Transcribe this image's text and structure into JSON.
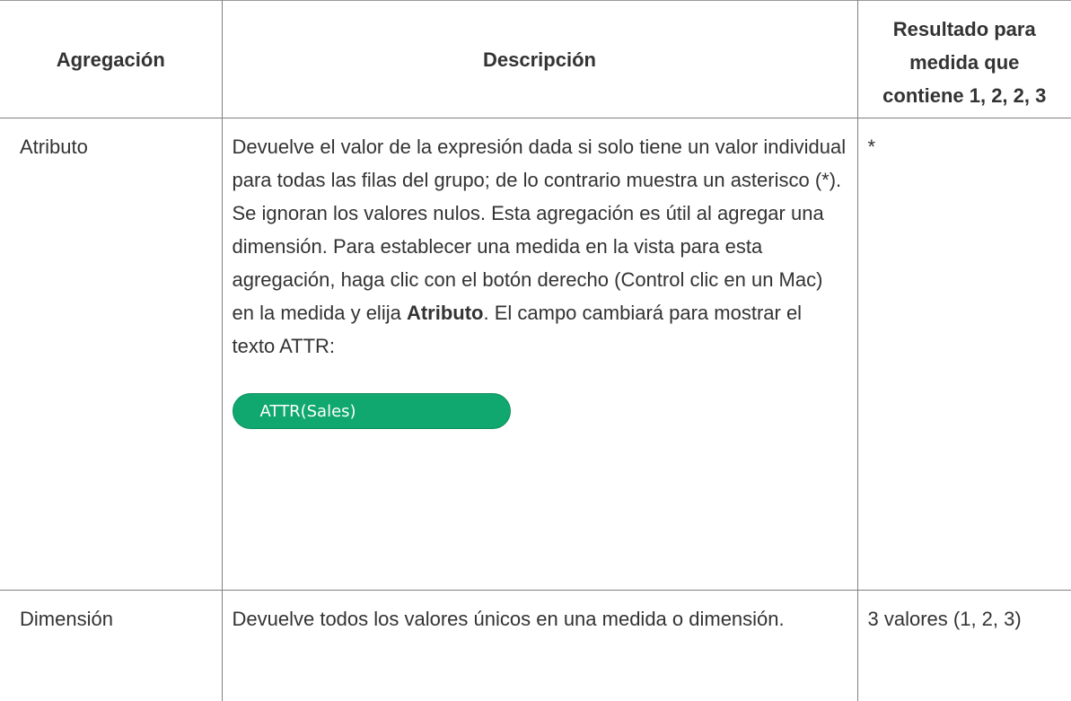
{
  "table": {
    "headers": {
      "aggregation": "Agregación",
      "description": "Descripción",
      "result_line1": "Resultado para",
      "result_line2": "medida que",
      "result_line3": "contiene 1, 2, 2, 3"
    },
    "rows": [
      {
        "aggregation": "Atributo",
        "description_before_bold": "Devuelve el valor de la expresión dada si solo tiene un valor individual para todas las filas del grupo; de lo contrario muestra un asterisco (*). Se ignoran los valores nulos. Esta agregación es útil al agregar una dimensión. Para establecer una medida en la vista para esta agregación, haga clic con el botón derecho (Control clic en un Mac) en la medida y elija ",
        "description_bold": "Atributo",
        "description_after_bold": ". El campo cambiará para mostrar el texto ATTR:",
        "field_pill": "ATTR(Sales)",
        "result": "*"
      },
      {
        "aggregation": "Dimensión",
        "description": "Devuelve todos los valores únicos en una medida o dimensión.",
        "result": "3 valores (1, 2, 3)"
      }
    ]
  },
  "colors": {
    "pill_background": "#10a86e",
    "pill_text": "#ffffff",
    "text": "#333333",
    "border": "#808080"
  }
}
